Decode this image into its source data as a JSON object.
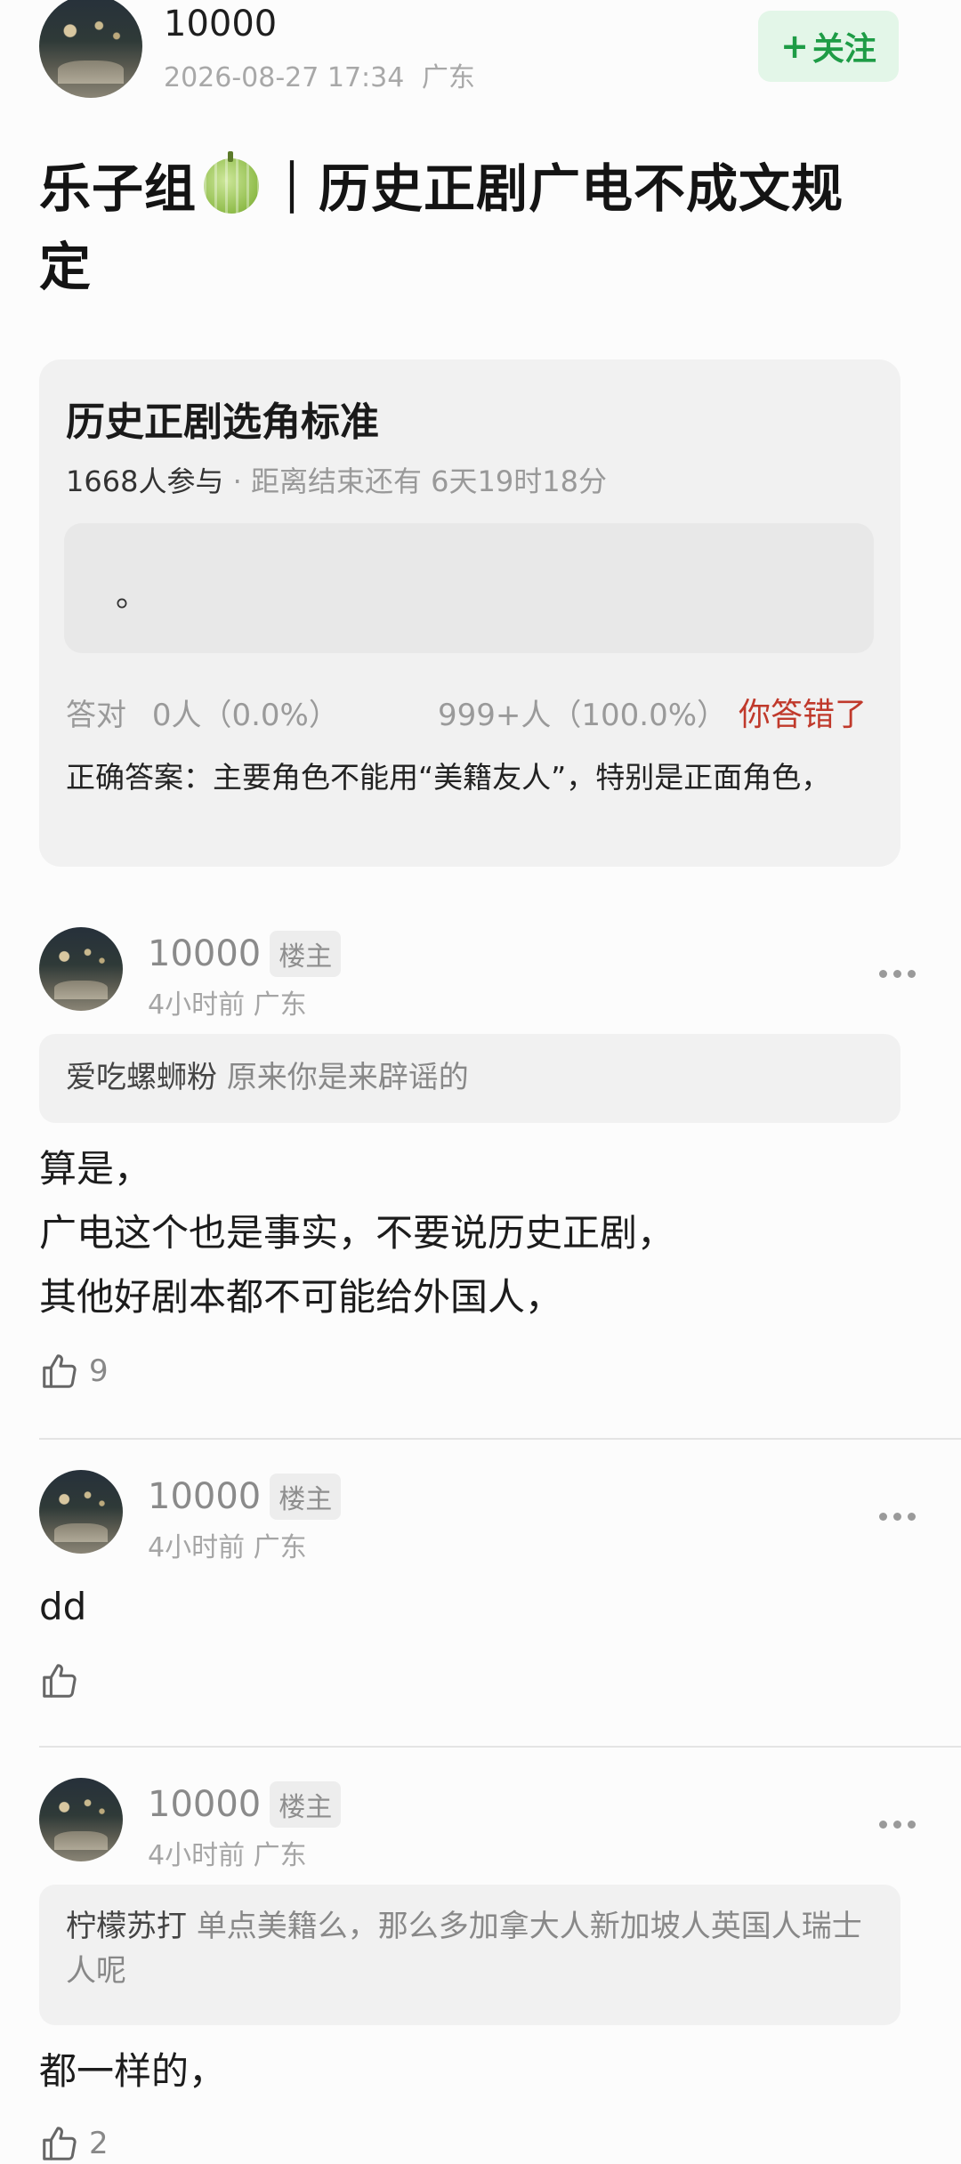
{
  "header": {
    "user_name": "10000",
    "timestamp": "2026-08-27 17:34",
    "location": "广东",
    "follow_label": "关注"
  },
  "post": {
    "title_part1": "乐子组",
    "title_part2": "｜历史正剧广电不成文规",
    "title_part3": "定"
  },
  "quiz": {
    "title": "历史正剧选角标准",
    "participants": "1668人参与",
    "deadline": "· 距离结束还有 6天19时18分",
    "option_text": "。",
    "correct_label": "答对",
    "correct_stat": "0人（0.0%）",
    "other_stat": "999+人（100.0%）",
    "result": "你答错了",
    "answer": "正确答案：主要角色不能用“美籍友人”，特别是正面角色，"
  },
  "comments": [
    {
      "name": "10000",
      "badge": "楼主",
      "meta": "4小时前 广东",
      "quote_user": "爱吃螺蛳粉",
      "quote_text": "原来你是来辟谣的",
      "body": "算是，\n广电这个也是事实，不要说历史正剧，\n其他好剧本都不可能给外国人，",
      "likes": "9"
    },
    {
      "name": "10000",
      "badge": "楼主",
      "meta": "4小时前 广东",
      "body": "dd",
      "likes": ""
    },
    {
      "name": "10000",
      "badge": "楼主",
      "meta": "4小时前 广东",
      "quote_user": "柠檬苏打",
      "quote_text": "单点美籍么，那么多加拿大人新加坡人英国人瑞士人呢",
      "body": "都一样的，",
      "likes": "2"
    }
  ],
  "icons": {
    "like": "thumbs-up-icon",
    "more": "more-dots-icon",
    "melon": "melon-emoji-icon",
    "plus": "plus-icon"
  },
  "colors": {
    "follow_green": "#1e9c46",
    "follow_bg": "#e3f6e8",
    "wrong_red": "#c0392b"
  }
}
